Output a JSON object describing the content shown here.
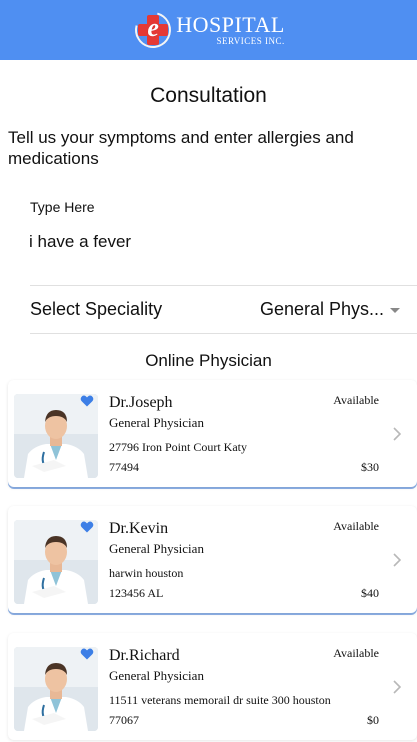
{
  "header": {
    "logo_title": "HOSPITAL",
    "logo_subtitle": "SERVICES INC.",
    "logo_letter": "e",
    "background_color": "#4f8ff2"
  },
  "page": {
    "title": "Consultation",
    "instructions": "Tell us your symptoms and enter allergies and medications"
  },
  "symptoms": {
    "label": "Type Here",
    "value": "i have a fever"
  },
  "speciality": {
    "label": "Select Speciality",
    "selected": "General Phys..."
  },
  "physicians": {
    "section_title": "Online Physician",
    "items": [
      {
        "name": "Dr.Joseph",
        "speciality": "General Physician",
        "address": "27796 Iron Point Court Katy",
        "zip": "77494",
        "status": "Available",
        "price": "$30"
      },
      {
        "name": "Dr.Kevin",
        "speciality": "General Physician",
        "address": "harwin houston",
        "zip": "123456 AL",
        "status": "Available",
        "price": "$40"
      },
      {
        "name": "Dr.Richard",
        "speciality": "General Physician",
        "address": "11511 veterans memorail dr suite 300 houston",
        "zip": "77067",
        "status": "Available",
        "price": "$0"
      }
    ]
  },
  "colors": {
    "accent": "#4f8ff2",
    "heart": "#3d7fe6",
    "card_shadow": "#8fb3ea"
  },
  "icons": {
    "favorite": "heart-icon",
    "next": "chevron-right-icon",
    "dropdown": "caret-down-icon"
  }
}
